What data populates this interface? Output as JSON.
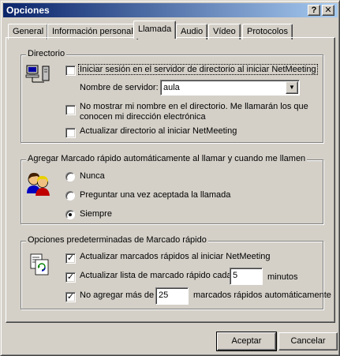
{
  "window": {
    "title": "Opciones",
    "help_btn": "?",
    "close_btn": "✕"
  },
  "tabs": [
    {
      "label": "General",
      "active": false
    },
    {
      "label": "Información personal",
      "active": false
    },
    {
      "label": "Llamada",
      "active": true
    },
    {
      "label": "Audio",
      "active": false
    },
    {
      "label": "Vídeo",
      "active": false
    },
    {
      "label": "Protocolos",
      "active": false
    }
  ],
  "directory": {
    "legend": "Directorio",
    "icon": "network-computer-icon",
    "login_check": {
      "label": "Iniciar sesión en el servidor de directorio al iniciar NetMeeting",
      "checked": false
    },
    "server_label": "Nombre de servidor:",
    "server_value": "aula",
    "hide_name_check": {
      "label_line1": "No mostrar mi nombre en el directorio. Me llamarán los que",
      "label_line2": "conocen mi dirección electrónica",
      "checked": false
    },
    "update_check": {
      "label": "Actualizar directorio al iniciar NetMeeting",
      "checked": false
    }
  },
  "autodial": {
    "legend": "Agregar Marcado rápido automáticamente al llamar y cuando me llamen",
    "icon": "people-icon",
    "options": [
      {
        "label": "Nunca",
        "selected": false
      },
      {
        "label": "Preguntar una vez aceptada la llamada",
        "selected": false
      },
      {
        "label": "Siempre",
        "selected": true
      }
    ]
  },
  "speeddial": {
    "legend": "Opciones predeterminadas de Marcado rápido",
    "icon": "refresh-document-icon",
    "update_check": {
      "label": "Actualizar marcados rápidos al iniciar NetMeeting",
      "checked": true
    },
    "list_check": {
      "label": "Actualizar lista de marcado rápido cada",
      "checked": true,
      "value": "5",
      "unit": "minutos"
    },
    "max_check": {
      "label": "No agregar más de",
      "checked": true,
      "value": "25",
      "suffix": "marcados rápidos automáticamente"
    }
  },
  "buttons": {
    "accept": "Aceptar",
    "cancel": "Cancelar"
  }
}
